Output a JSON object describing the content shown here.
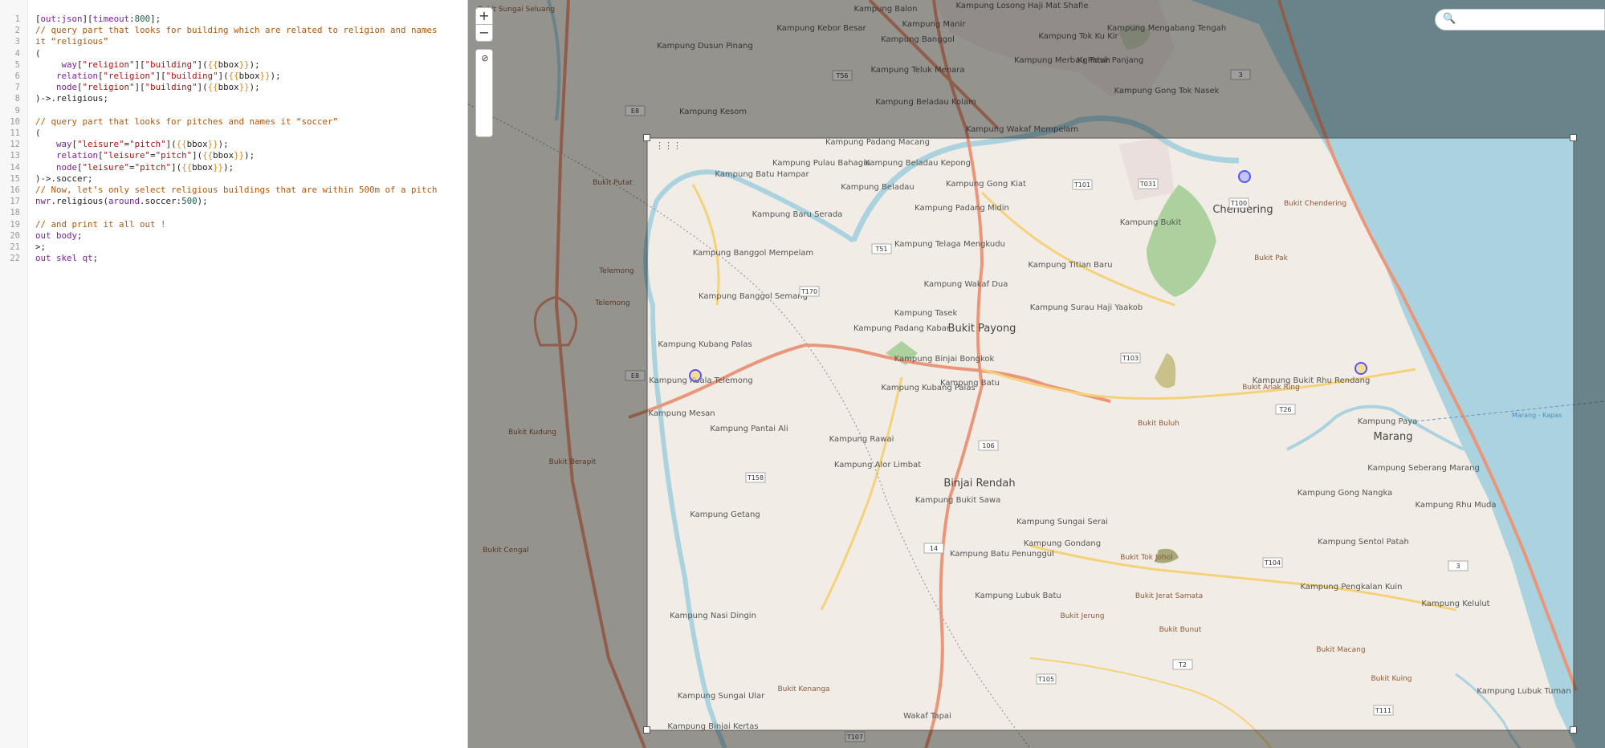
{
  "editor": {
    "lines": [
      [
        [
          "t",
          "c-t",
          "["
        ],
        [
          "t",
          "c-k",
          "out"
        ],
        [
          "t",
          "c-t",
          ":"
        ],
        [
          "t",
          "c-k",
          "json"
        ],
        [
          "t",
          "c-t",
          "]["
        ],
        [
          "t",
          "c-k",
          "timeout"
        ],
        [
          "t",
          "c-t",
          ":"
        ],
        [
          "t",
          "c-n",
          "800"
        ],
        [
          "t",
          "c-t",
          "];"
        ]
      ],
      [
        [
          "t",
          "c-c",
          "// query part that looks for building which are related to religion and names"
        ]
      ],
      [
        [
          "t",
          "c-c",
          "it “religious”"
        ]
      ],
      [
        [
          "t",
          "c-t",
          "("
        ]
      ],
      [
        [
          "t",
          "c-t",
          "     "
        ],
        [
          "t",
          "c-k",
          "way"
        ],
        [
          "t",
          "c-t",
          "["
        ],
        [
          "t",
          "c-s",
          "\"religion\""
        ],
        [
          "t",
          "c-t",
          "]["
        ],
        [
          "t",
          "c-s",
          "\"building\""
        ],
        [
          "t",
          "c-t",
          "]("
        ],
        [
          "t",
          "c-p",
          "{{"
        ],
        [
          "t",
          "c-t",
          "bbox"
        ],
        [
          "t",
          "c-p",
          "}}"
        ],
        [
          "t",
          "c-t",
          ");"
        ]
      ],
      [
        [
          "t",
          "c-t",
          "    "
        ],
        [
          "t",
          "c-k",
          "relation"
        ],
        [
          "t",
          "c-t",
          "["
        ],
        [
          "t",
          "c-s",
          "\"religion\""
        ],
        [
          "t",
          "c-t",
          "]["
        ],
        [
          "t",
          "c-s",
          "\"building\""
        ],
        [
          "t",
          "c-t",
          "]("
        ],
        [
          "t",
          "c-p",
          "{{"
        ],
        [
          "t",
          "c-t",
          "bbox"
        ],
        [
          "t",
          "c-p",
          "}}"
        ],
        [
          "t",
          "c-t",
          ");"
        ]
      ],
      [
        [
          "t",
          "c-t",
          "    "
        ],
        [
          "t",
          "c-k",
          "node"
        ],
        [
          "t",
          "c-t",
          "["
        ],
        [
          "t",
          "c-s",
          "\"religion\""
        ],
        [
          "t",
          "c-t",
          "]["
        ],
        [
          "t",
          "c-s",
          "\"building\""
        ],
        [
          "t",
          "c-t",
          "]("
        ],
        [
          "t",
          "c-p",
          "{{"
        ],
        [
          "t",
          "c-t",
          "bbox"
        ],
        [
          "t",
          "c-p",
          "}}"
        ],
        [
          "t",
          "c-t",
          ");"
        ]
      ],
      [
        [
          "t",
          "c-t",
          ")->.religious;"
        ]
      ],
      [
        [
          "t",
          "c-t",
          ""
        ]
      ],
      [
        [
          "t",
          "c-c",
          "// query part that looks for pitches and names it “soccer”"
        ]
      ],
      [
        [
          "t",
          "c-t",
          "("
        ]
      ],
      [
        [
          "t",
          "c-t",
          "    "
        ],
        [
          "t",
          "c-k",
          "way"
        ],
        [
          "t",
          "c-t",
          "["
        ],
        [
          "t",
          "c-s",
          "\"leisure\""
        ],
        [
          "t",
          "c-t",
          "="
        ],
        [
          "t",
          "c-s",
          "\"pitch\""
        ],
        [
          "t",
          "c-t",
          "]("
        ],
        [
          "t",
          "c-p",
          "{{"
        ],
        [
          "t",
          "c-t",
          "bbox"
        ],
        [
          "t",
          "c-p",
          "}}"
        ],
        [
          "t",
          "c-t",
          ");"
        ]
      ],
      [
        [
          "t",
          "c-t",
          "    "
        ],
        [
          "t",
          "c-k",
          "relation"
        ],
        [
          "t",
          "c-t",
          "["
        ],
        [
          "t",
          "c-s",
          "\"leisure\""
        ],
        [
          "t",
          "c-t",
          "="
        ],
        [
          "t",
          "c-s",
          "\"pitch\""
        ],
        [
          "t",
          "c-t",
          "]("
        ],
        [
          "t",
          "c-p",
          "{{"
        ],
        [
          "t",
          "c-t",
          "bbox"
        ],
        [
          "t",
          "c-p",
          "}}"
        ],
        [
          "t",
          "c-t",
          ");"
        ]
      ],
      [
        [
          "t",
          "c-t",
          "    "
        ],
        [
          "t",
          "c-k",
          "node"
        ],
        [
          "t",
          "c-t",
          "["
        ],
        [
          "t",
          "c-s",
          "\"leisure\""
        ],
        [
          "t",
          "c-t",
          "="
        ],
        [
          "t",
          "c-s",
          "\"pitch\""
        ],
        [
          "t",
          "c-t",
          "]("
        ],
        [
          "t",
          "c-p",
          "{{"
        ],
        [
          "t",
          "c-t",
          "bbox"
        ],
        [
          "t",
          "c-p",
          "}}"
        ],
        [
          "t",
          "c-t",
          ");"
        ]
      ],
      [
        [
          "t",
          "c-t",
          ")->.soccer;"
        ]
      ],
      [
        [
          "t",
          "c-c",
          "// Now, let’s only select religious buildings that are within 500m of a pitch"
        ]
      ],
      [
        [
          "t",
          "c-k",
          "nwr"
        ],
        [
          "t",
          "c-t",
          ".religious("
        ],
        [
          "t",
          "c-k",
          "around"
        ],
        [
          "t",
          "c-t",
          ".soccer:"
        ],
        [
          "t",
          "c-n",
          "500"
        ],
        [
          "t",
          "c-t",
          ");"
        ]
      ],
      [
        [
          "t",
          "c-t",
          ""
        ]
      ],
      [
        [
          "t",
          "c-c",
          "// and print it all out !"
        ]
      ],
      [
        [
          "t",
          "c-k",
          "out"
        ],
        [
          "t",
          "c-t",
          " "
        ],
        [
          "t",
          "c-k",
          "body"
        ],
        [
          "t",
          "c-t",
          ";"
        ]
      ],
      [
        [
          "t",
          "c-t",
          ">;"
        ]
      ],
      [
        [
          "t",
          "c-k",
          "out"
        ],
        [
          "t",
          "c-t",
          " "
        ],
        [
          "t",
          "c-k",
          "skel"
        ],
        [
          "t",
          "c-t",
          " "
        ],
        [
          "t",
          "c-k",
          "qt"
        ],
        [
          "t",
          "c-t",
          ";"
        ]
      ]
    ],
    "line_numbers": [
      "1",
      "2",
      "3",
      "4",
      "5",
      "6",
      "7",
      "8",
      "9",
      "10",
      "11",
      "12",
      "13",
      "14",
      "15",
      "16",
      "17",
      "18",
      "19",
      "20",
      "21",
      "22"
    ]
  },
  "map": {
    "controls": {
      "zoom_in": "+",
      "zoom_out": "−"
    },
    "tools": [
      "search-icon",
      "crosshair-icon",
      "layers-icon",
      "skip-back-icon",
      "no-entry-icon"
    ],
    "search": {
      "placeholder": ""
    },
    "colors": {
      "sea": "#aad3df",
      "land": "#f2efe9",
      "forest": "#add19e",
      "road_primary": "#e9967a",
      "road_secondary": "#f5d27a",
      "river": "#aad3df",
      "result_marker": "#5555ff"
    },
    "place_labels": [
      "Bukit Sungai Seluang",
      "Kampung Balon",
      "Kampung Losong Haji Mat Shafie",
      "Kampung Manir",
      "Kampung Kebor Besar",
      "Kampung Banggol",
      "Kampung Tok Ku Kir",
      "Kampung Mengabang Tengah",
      "Kampung Dusun Pinang",
      "Kampung Teluk Menara",
      "Kampung Merbau Patah",
      "Kg Pasir Panjang",
      "Kampung Gong Tok Nasek",
      "Kampung Beladau Kolam",
      "Kampung Kesom",
      "Kampung Wakaf Mempelam",
      "Kampung Padang Macang",
      "Kampung Pulau Bahagia",
      "Kampung Beladau Kepong",
      "Kampung Batu Hampar",
      "Kampung Beladau",
      "Kampung Gong Kiat",
      "Bukit Putat",
      "Chendering",
      "Bukit Chendering",
      "Kampung Baru Serada",
      "Kampung Padang Midin",
      "Kampung Bukit",
      "Kampung Banggol Mempelam",
      "Kampung Telaga Mengkudu",
      "Kampung Titian Baru",
      "Bukit Pak",
      "Kampung Wakaf Dua",
      "Kampung Banggol Semang",
      "Kampung Surau Haji Yaakob",
      "Kampung Tasek",
      "Kampung Padang Kabar",
      "Bukit Payong",
      "Kampung Kubang Palas",
      "Kampung Binjai Bongkok",
      "Kampung Kuala Telemong",
      "Kampung Mesan",
      "Kampung Kubang Palas",
      "Kampung Batu",
      "Bukit Anak Ring",
      "Kampung Bukit Rhu Rendang",
      "Bukit Kudung",
      "Kampung Pantai Ali",
      "Bukit Buluh",
      "Kampung Paya",
      "Marang",
      "Kampung Rawai",
      "Bukit Berapit",
      "Kampung Alor Limbat",
      "Binjai Rendah",
      "Kampung Seberang Marang",
      "Kampung Gong Nangka",
      "Kampung Rhu Muda",
      "Kampung Bukit Sawa",
      "Kampung Getang",
      "Kampung Sungai Serai",
      "Bukit Cengal",
      "Kampung Gondang",
      "Kampung Batu Penunggul",
      "Bukit Tok Johol",
      "Kampung Sentol Patah",
      "Kampung Pengkalan Kuin",
      "Bukit Jerat Samata",
      "Kampung Lubuk Batu",
      "Kampung Nasi Dingin",
      "Bukit Jerung",
      "Bukit Bunut",
      "Kampung Kelulut",
      "Bukit Macang",
      "Bukit Kuing",
      "Bukit Kenanga",
      "Kampung Sungai Ular",
      "Kampung Lubuk Tuman",
      "Kampung Binjai Kertas",
      "Wakaf Tapai",
      "Marang - Kapas",
      "Telemong",
      "Telemong"
    ],
    "road_refs": [
      "T56",
      "T101",
      "T031",
      "T100",
      "T51",
      "T170",
      "T103",
      "T26",
      "106",
      "T158",
      "14",
      "T104",
      "T105",
      "T2",
      "T111",
      "T107",
      "E8",
      "E8",
      "3",
      "3"
    ]
  }
}
